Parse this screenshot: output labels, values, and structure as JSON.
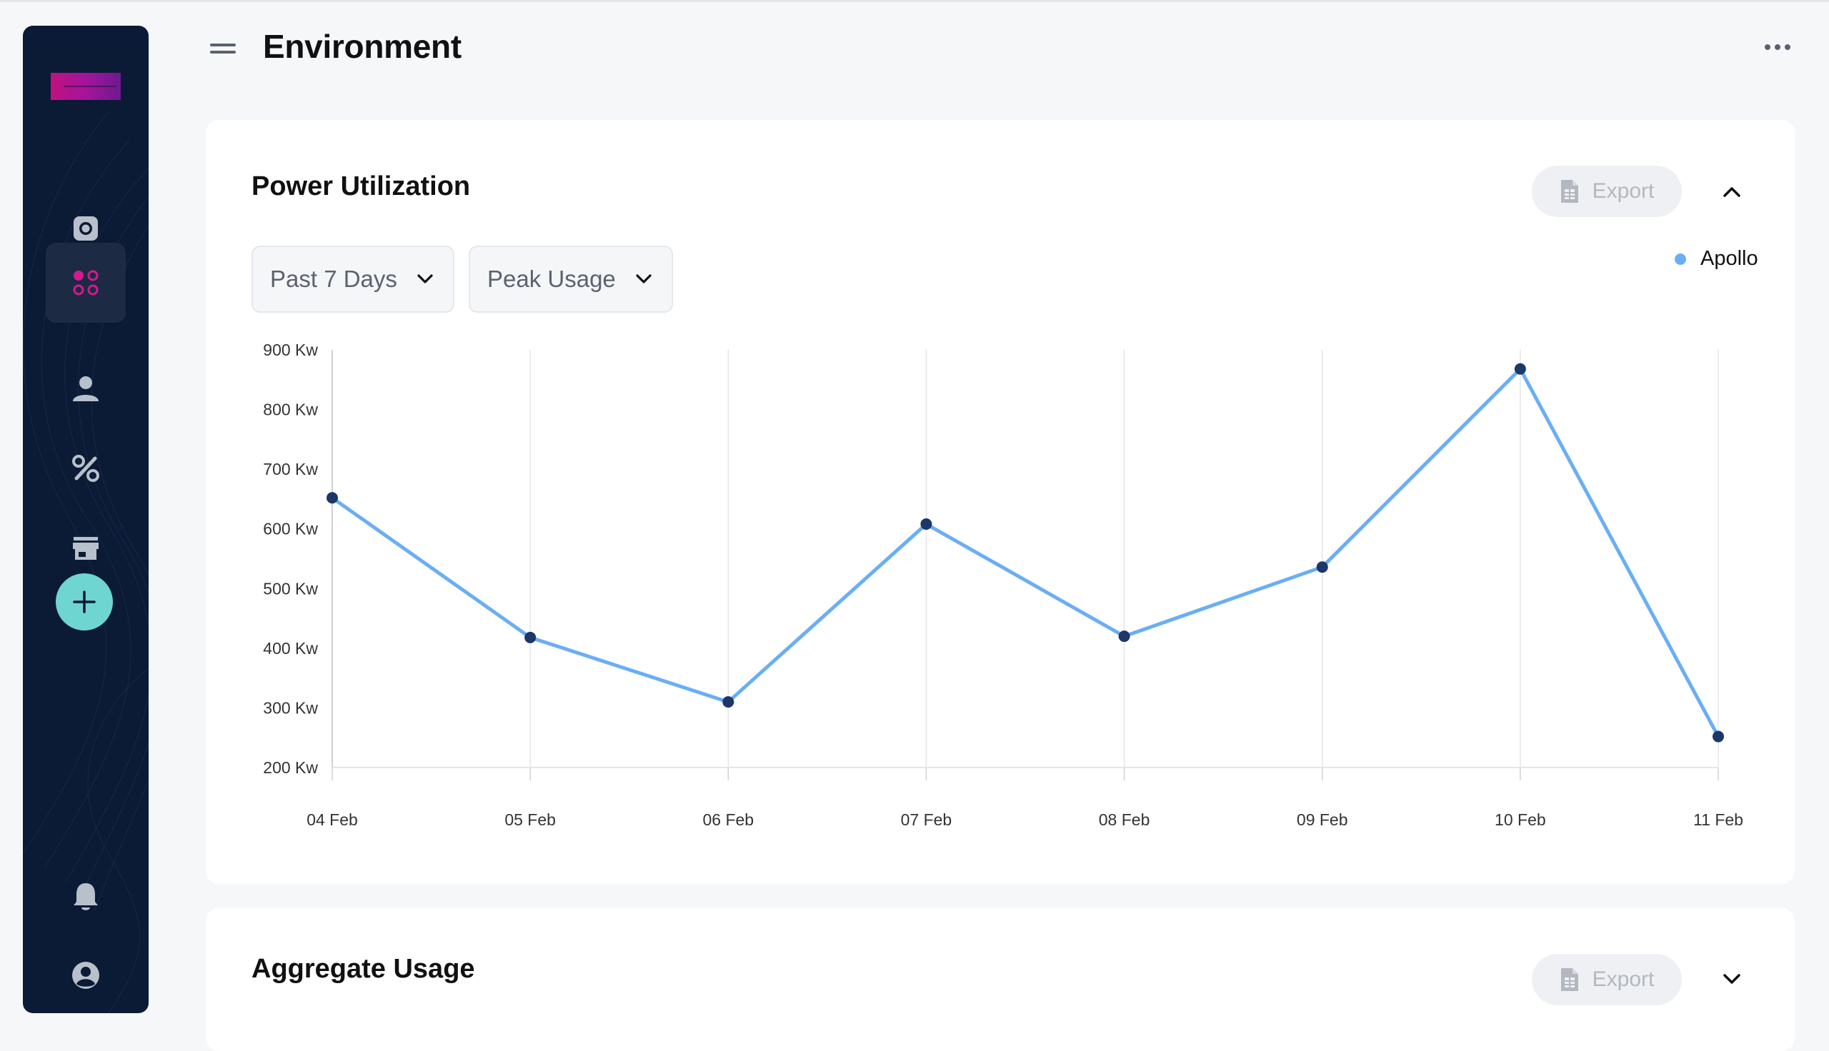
{
  "page": {
    "title": "Environment"
  },
  "sidebar": {
    "items": [
      {
        "icon": "camera-icon",
        "active": false
      },
      {
        "icon": "apps-grid-icon",
        "active": true
      },
      {
        "icon": "user-icon",
        "active": false
      },
      {
        "icon": "percent-icon",
        "active": false
      },
      {
        "icon": "store-icon",
        "active": false
      }
    ],
    "add_icon": "plus-icon",
    "bottom": [
      {
        "icon": "bell-icon"
      },
      {
        "icon": "account-circle-icon"
      }
    ]
  },
  "header": {
    "menu_icon": "menu-icon",
    "more_icon": "more-horizontal-icon"
  },
  "power_card": {
    "title": "Power Utilization",
    "export_label": "Export",
    "period_select": "Past 7 Days",
    "metric_select": "Peak Usage",
    "collapse_icon": "chevron-up-icon"
  },
  "aggregate_card": {
    "title": "Aggregate Usage",
    "export_label": "Export",
    "expand_icon": "chevron-down-icon"
  },
  "colors": {
    "accent_pink": "#d31a8d",
    "line": "#6aaef5",
    "point": "#1c3768",
    "add_button": "#6fd5d1",
    "sidebar_bg": "#0b1a35"
  },
  "chart_data": {
    "type": "line",
    "categories": [
      "04 Feb",
      "05 Feb",
      "06 Feb",
      "07 Feb",
      "08 Feb",
      "09 Feb",
      "10 Feb",
      "11 Feb"
    ],
    "series": [
      {
        "name": "Apollo",
        "values": [
          652,
          418,
          310,
          608,
          420,
          536,
          868,
          252
        ]
      }
    ],
    "y_ticks": [
      "200 Kw",
      "300 Kw",
      "400 Kw",
      "500 Kw",
      "600 Kw",
      "700 Kw",
      "800 Kw",
      "900 Kw"
    ],
    "ylim": [
      200,
      900
    ],
    "grid": "vertical",
    "legend_position": "top-right"
  }
}
